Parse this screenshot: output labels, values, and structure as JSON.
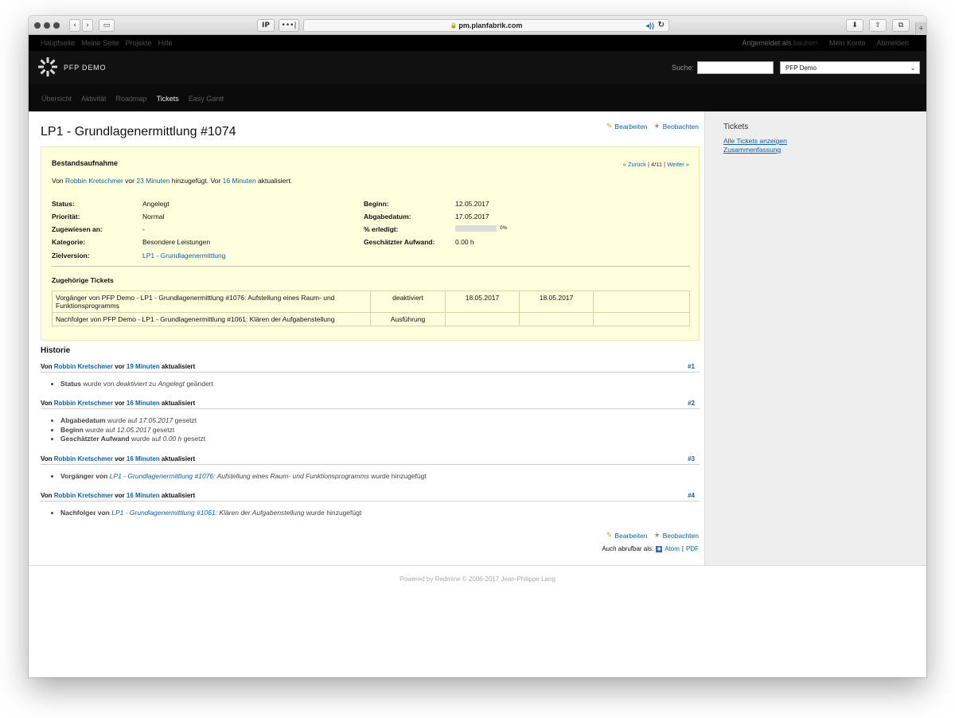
{
  "browser": {
    "ip_button": "IP",
    "more_button": "•••|",
    "url": "pm.planfabrik.com",
    "audio_icon": "speaker-icon",
    "reload_icon": "reload-icon",
    "plus": "+"
  },
  "topmenu": {
    "left": [
      "Hauptseite",
      "Meine Seite",
      "Projekte",
      "Hilfe"
    ],
    "logged_in_prefix": "Angemeldet als",
    "user": "bauherr",
    "account": "Mein Konto",
    "logout": "Abmelden"
  },
  "header": {
    "project_title": "PFP DEMO",
    "search_label": "Suche:",
    "search_value": "",
    "project_select": "PFP Demo"
  },
  "mainmenu": [
    "Übersicht",
    "Aktivität",
    "Roadmap",
    "Tickets",
    "Easy Gantt"
  ],
  "mainmenu_selected": "Tickets",
  "actions": {
    "edit": "Bearbeiten",
    "watch": "Beobachten"
  },
  "issue": {
    "title": "LP1 - Grundlagenermittlung #1074",
    "subject": "Bestandsaufnahme",
    "pager": {
      "prev": "« Zurück",
      "pos": "4/11",
      "next": "Weiter »"
    },
    "author": {
      "von": "Von",
      "name": "Robbin Kretschmer",
      "vor": "vor",
      "added_ago": "23 Minuten",
      "added_text": "hinzugefügt. Vor",
      "updated_ago": "16 Minuten",
      "updated_text": "aktualisiert."
    },
    "attributes_left": [
      {
        "label": "Status:",
        "value": "Angelegt"
      },
      {
        "label": "Priorität:",
        "value": "Normal"
      },
      {
        "label": "Zugewiesen an:",
        "value": "-"
      },
      {
        "label": "Kategorie:",
        "value": "Besondere Leistungen"
      },
      {
        "label": "Zielversion:",
        "value": "LP1 - Grundlagenermittlung"
      }
    ],
    "attributes_right": [
      {
        "label": "Beginn:",
        "value": "12.05.2017"
      },
      {
        "label": "Abgabedatum:",
        "value": "17.05.2017"
      },
      {
        "label": "% erledigt:",
        "value": "0%"
      },
      {
        "label": "Geschätzter Aufwand:",
        "value": "0.00 h"
      }
    ],
    "done_ratio": 0,
    "relations_title": "Zugehörige Tickets",
    "relations": [
      {
        "text": "Vorgänger von PFP Demo - LP1 - Grundlagenermittlung #1076: Aufstellung eines Raum- und Funktionsprogramms",
        "status": "deaktiviert",
        "start": "18.05.2017",
        "due": "18.05.2017",
        "extra": ""
      },
      {
        "text": "Nachfolger von PFP Demo - LP1 - Grundlagenermittlung #1061: Klären der Aufgabenstellung",
        "status": "Ausführung",
        "start": "",
        "due": "",
        "extra": ""
      }
    ]
  },
  "history": {
    "title": "Historie",
    "journals": [
      {
        "von": "Von",
        "user": "Robbin Kretschmer",
        "vor": "vor",
        "ago": "19 Minuten",
        "action": "aktualisiert",
        "num": "#1",
        "details": [
          {
            "field": "Status",
            "t1": " wurde von ",
            "old": "deaktiviert",
            "t2": " zu ",
            "new": "Angelegt",
            "t3": " geändert"
          }
        ]
      },
      {
        "von": "Von",
        "user": "Robbin Kretschmer",
        "vor": "vor",
        "ago": "16 Minuten",
        "action": "aktualisiert",
        "num": "#2",
        "details": [
          {
            "field": "Abgabedatum",
            "t1": " wurde auf ",
            "value": "17.05.2017",
            "t2": " gesetzt"
          },
          {
            "field": "Beginn",
            "t1": " wurde auf ",
            "value": "12.05.2017",
            "t2": " gesetzt"
          },
          {
            "field": "Geschätzter Aufwand",
            "t1": " wurde auf ",
            "value": "0.00 h",
            "t2": " gesetzt"
          }
        ]
      },
      {
        "von": "Von",
        "user": "Robbin Kretschmer",
        "vor": "vor",
        "ago": "16 Minuten",
        "action": "aktualisiert",
        "num": "#3",
        "details": [
          {
            "field": "Vorgänger von",
            "link": "LP1 - Grundlagenermittlung #1076",
            "rest": ": Aufstellung eines Raum- und Funktionsprogramms",
            "tail": " wurde hinzugefügt"
          }
        ]
      },
      {
        "von": "Von",
        "user": "Robbin Kretschmer",
        "vor": "vor",
        "ago": "16 Minuten",
        "action": "aktualisiert",
        "num": "#4",
        "details": [
          {
            "field": "Nachfolger von",
            "link": "LP1 - Grundlagenermittlung #1061",
            "rest": ": Klären der Aufgabenstellung",
            "tail": " wurde hinzugefügt"
          }
        ]
      }
    ]
  },
  "also_available": {
    "label": "Auch abrufbar als:",
    "atom": "Atom",
    "sep": "|",
    "pdf": "PDF"
  },
  "sidebar": {
    "title": "Tickets",
    "links": [
      "Alle Tickets anzeigen",
      "Zusammenfassung"
    ]
  },
  "footer": "Powered by Redmine © 2006-2017 Jean-Philippe Lang",
  "colors": {
    "link": "#0b62a8",
    "issue_bg": "#ffffdd",
    "header_bg": "#111111",
    "sidebar_bg": "#eeeeee"
  }
}
